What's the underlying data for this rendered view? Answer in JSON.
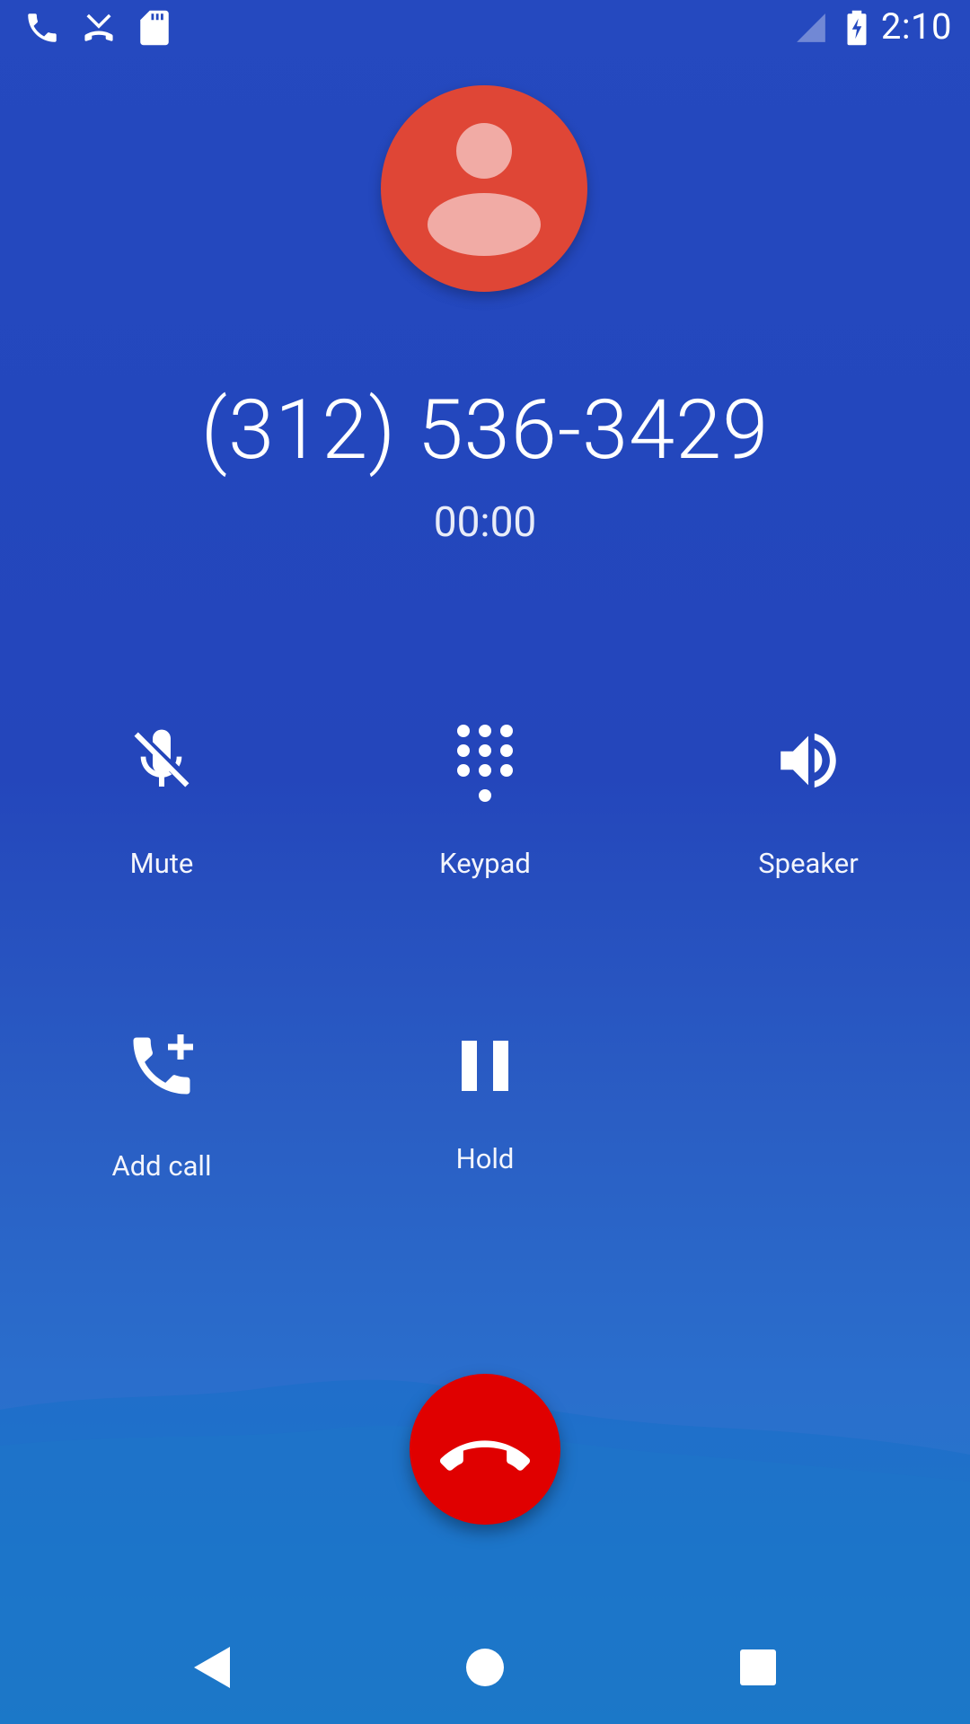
{
  "status_bar": {
    "time": "2:10",
    "left_icons": [
      "phone-icon",
      "missed-call-icon",
      "sd-card-icon"
    ],
    "right_icons": [
      "signal-icon",
      "battery-charging-icon"
    ]
  },
  "call": {
    "phone_number": "(312) 536-3429",
    "duration": "00:00",
    "avatar_color": "#df4636"
  },
  "controls": [
    {
      "label": "Mute",
      "icon": "mic-off-icon"
    },
    {
      "label": "Keypad",
      "icon": "dialpad-icon"
    },
    {
      "label": "Speaker",
      "icon": "volume-up-icon"
    },
    {
      "label": "Add call",
      "icon": "add-call-icon"
    },
    {
      "label": "Hold",
      "icon": "pause-icon"
    }
  ],
  "end_call": {
    "icon": "call-end-icon",
    "color": "#e00000"
  },
  "nav_bar": {
    "icons": [
      "back-icon",
      "home-icon",
      "recents-icon"
    ]
  },
  "colors": {
    "background_top": "#2549bf",
    "background_bottom": "#2280c9"
  }
}
